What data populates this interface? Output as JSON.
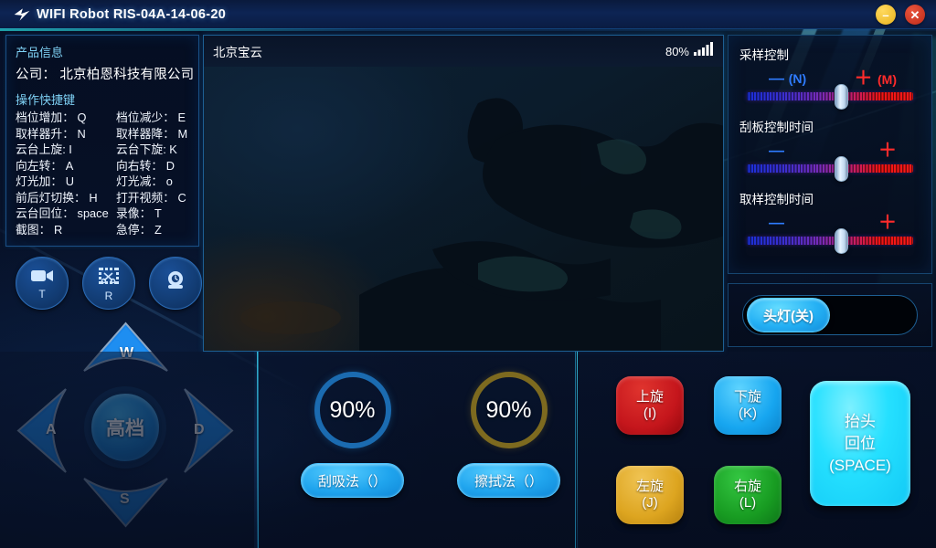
{
  "window": {
    "title": "WIFI Robot RIS-04A-14-06-20",
    "logo_icon": "robot-logo-icon",
    "minimize_label": "–",
    "close_label": "✕"
  },
  "info_panel": {
    "heading": "产品信息",
    "company": "公司： 北京柏恩科技有限公司",
    "shortcuts_heading": "操作快捷键",
    "shortcuts": [
      "档位增加： Q",
      "档位减少： E",
      "取样器升： N",
      "取样器降： M",
      "云台上旋: I",
      "云台下旋: K",
      "向左转： A",
      "向右转： D",
      "灯光加： U",
      "灯光减： o",
      "前后灯切换： H",
      "打开视频： C",
      "云台回位： space",
      "录像： T",
      "截图： R",
      "急停： Z"
    ]
  },
  "round_buttons": [
    {
      "name": "record-video-button",
      "icon": "video-camera-icon",
      "key": "T"
    },
    {
      "name": "screenshot-button",
      "icon": "screenshot-crop-icon",
      "key": "R"
    },
    {
      "name": "open-camera-button",
      "icon": "webcam-icon",
      "key": ""
    }
  ],
  "dpad": {
    "up": "W",
    "left": "A",
    "right": "D",
    "down": "S",
    "center": "高档"
  },
  "video": {
    "title": "北京宝云",
    "signal_percent": "80%",
    "signal_icon": "signal-bars-icon"
  },
  "sliders": [
    {
      "name": "sampling-control",
      "title": "采样控制",
      "minus": "—",
      "minus_key": "(N)",
      "plus": "＋",
      "plus_key": "(M)",
      "value": 50
    },
    {
      "name": "scraper-control-time",
      "title": "刮板控制时间",
      "minus": "—",
      "minus_key": "",
      "plus": "＋",
      "plus_key": "",
      "value": 50
    },
    {
      "name": "sampling-control-time",
      "title": "取样控制时间",
      "minus": "—",
      "minus_key": "",
      "plus": "＋",
      "plus_key": "",
      "value": 50
    }
  ],
  "headlight": {
    "label": "头灯(关)"
  },
  "gauges": [
    {
      "name": "scrape-suction-gauge",
      "value": "90%",
      "color": "#1b6bb0",
      "button": "刮吸法（）"
    },
    {
      "name": "wipe-method-gauge",
      "value": "90%",
      "color": "#7d6a1f",
      "button": "擦拭法（）"
    }
  ],
  "rotation_buttons": [
    {
      "name": "rotate-up-button",
      "line1": "上旋",
      "line2": "(I)",
      "color": "#c5161c"
    },
    {
      "name": "rotate-down-button",
      "line1": "下旋",
      "line2": "(K)",
      "color": "#17a6f0"
    },
    {
      "name": "rotate-left-button",
      "line1": "左旋",
      "line2": "(J)",
      "color": "#dda520"
    },
    {
      "name": "rotate-right-button",
      "line1": "右旋",
      "line2": "(L)",
      "color": "#189c22"
    }
  ],
  "space_button": {
    "line1": "抬头",
    "line2": "回位",
    "line3": "(SPACE)"
  },
  "colors": {
    "accent_cyan": "#2fd4f5",
    "accent_blue": "#1a86d8",
    "panel_border": "#1a4f86",
    "bg_dark": "#061027"
  }
}
